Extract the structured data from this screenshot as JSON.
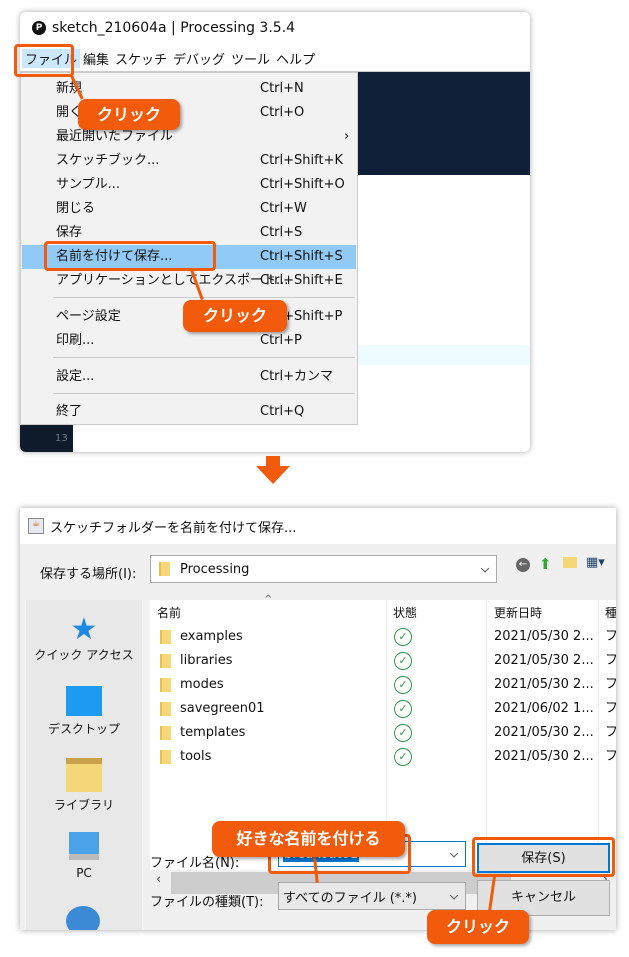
{
  "window": {
    "title": "sketch_210604a | Processing 3.5.4",
    "logo": "P",
    "line_number": "13"
  },
  "menubar": [
    "ファイル",
    "編集",
    "スケッチ",
    "デバッグ",
    "ツール",
    "ヘルプ"
  ],
  "file_menu": [
    {
      "label": "新規",
      "shortcut": "Ctrl+N"
    },
    {
      "label": "開く...",
      "shortcut": "Ctrl+O"
    },
    {
      "label": "最近開いたファイル",
      "shortcut": "›"
    },
    {
      "label": "スケッチブック...",
      "shortcut": "Ctrl+Shift+K"
    },
    {
      "label": "サンプル...",
      "shortcut": "Ctrl+Shift+O"
    },
    {
      "label": "閉じる",
      "shortcut": "Ctrl+W"
    },
    {
      "label": "保存",
      "shortcut": "Ctrl+S"
    },
    {
      "label": "名前を付けて保存...",
      "shortcut": "Ctrl+Shift+S"
    },
    {
      "label": "アプリケーションとしてエクスポート...",
      "shortcut": "Ctrl+Shift+E"
    },
    {
      "label": "ページ設定",
      "shortcut": "Ctrl+Shift+P"
    },
    {
      "label": "印刷...",
      "shortcut": "Ctrl+P"
    },
    {
      "label": "設定...",
      "shortcut": "Ctrl+カンマ"
    },
    {
      "label": "終了",
      "shortcut": "Ctrl+Q"
    }
  ],
  "callouts": {
    "click1": "クリック",
    "click2": "クリック",
    "name": "好きな名前を付ける",
    "click3": "クリック"
  },
  "dialog": {
    "title": "スケッチフォルダーを名前を付けて保存...",
    "location_label": "保存する場所(I):",
    "location_value": "Processing",
    "sidebar": [
      "クイック アクセス",
      "デスクトップ",
      "ライブラリ",
      "PC"
    ],
    "columns": [
      "名前",
      "状態",
      "更新日時",
      "種"
    ],
    "files": [
      {
        "name": "examples",
        "date": "2021/05/30 2...",
        "type": "フ"
      },
      {
        "name": "libraries",
        "date": "2021/05/30 2...",
        "type": "フ"
      },
      {
        "name": "modes",
        "date": "2021/05/30 2...",
        "type": "フ"
      },
      {
        "name": "savegreen01",
        "date": "2021/06/02 1...",
        "type": "フ"
      },
      {
        "name": "templates",
        "date": "2021/05/30 2...",
        "type": "フ"
      },
      {
        "name": "tools",
        "date": "2021/05/30 2...",
        "type": "フ"
      }
    ],
    "filename_label": "ファイル名(N):",
    "filename_value": "breakout01",
    "filetype_label": "ファイルの種類(T):",
    "filetype_value": "すべてのファイル (*.*)",
    "save_button": "保存(S)",
    "cancel_button": "キャンセル"
  },
  "colors": {
    "accent": "#f25a0c",
    "highlight": "#91c9f7",
    "status_ok": "#2e9c4a"
  }
}
